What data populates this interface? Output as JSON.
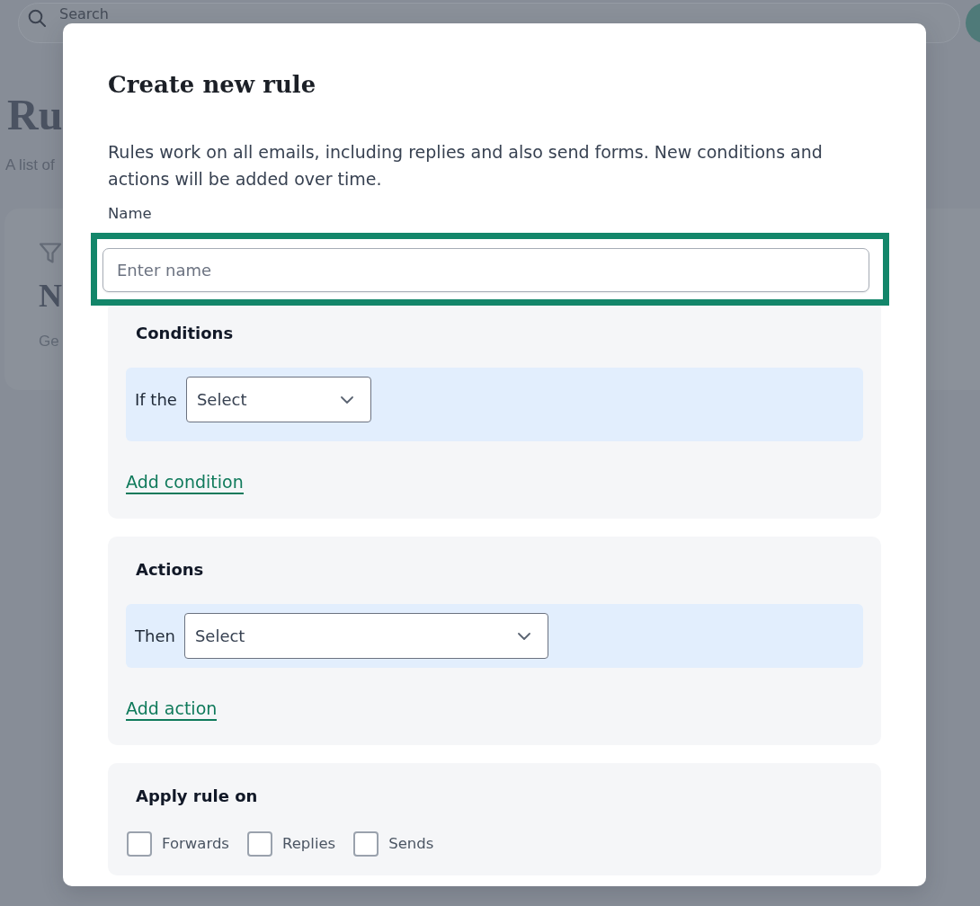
{
  "background_page": {
    "search": {
      "placeholder": "Search"
    },
    "heading": "Ru",
    "subtitle": "A list of",
    "card": {
      "title": "N",
      "text": "Ge"
    }
  },
  "dialog": {
    "title": "Create new rule",
    "description": "Rules work on all emails, including replies and also send forms. New conditions and actions will be added over time.",
    "name_field": {
      "label": "Name",
      "placeholder": "Enter name",
      "highlighted": true
    },
    "sections": [
      {
        "kind": "rows",
        "title": "Conditions",
        "rows": [
          {
            "label": "If the",
            "value": "Select"
          }
        ],
        "link": "Add condition"
      },
      {
        "kind": "rows",
        "title": "Actions",
        "rows": [
          {
            "label": "Then",
            "value": "Select"
          }
        ],
        "link": "Add action"
      },
      {
        "kind": "checkboxes",
        "title": "Apply rule on",
        "options": [
          {
            "label": "Forwards",
            "checked": false
          },
          {
            "label": "Replies",
            "checked": false
          },
          {
            "label": "Sends",
            "checked": false
          }
        ]
      }
    ]
  }
}
